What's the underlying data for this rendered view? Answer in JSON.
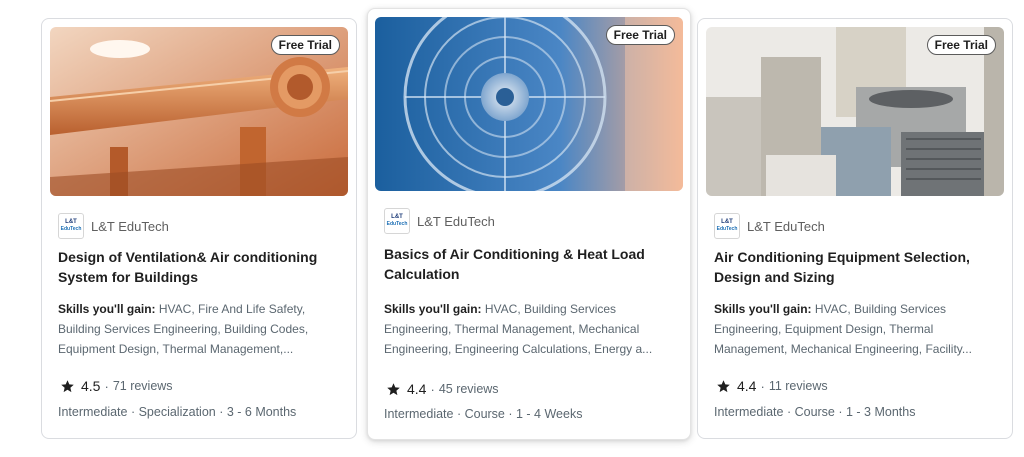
{
  "cards": [
    {
      "badge": "Free Trial",
      "partner": "L&T EduTech",
      "partner_logo_line1": "L&T",
      "partner_logo_line2": "EduTech",
      "title": "Design of Ventilation& Air conditioning System for Buildings",
      "skills_label": "Skills you'll gain:",
      "skills": "HVAC, Fire And Life Safety, Building Services Engineering, Building Codes, Equipment Design, Thermal Management,...",
      "rating": "4.5",
      "separator": "·",
      "reviews": "71 reviews",
      "meta": "Intermediate · Specialization · 3 - 6 Months",
      "image_icon": "ventilation-ducts-image"
    },
    {
      "badge": "Free Trial",
      "partner": "L&T EduTech",
      "partner_logo_line1": "L&T",
      "partner_logo_line2": "EduTech",
      "title": "Basics of Air Conditioning & Heat Load Calculation",
      "skills_label": "Skills you'll gain:",
      "skills": "HVAC, Building Services Engineering, Thermal Management, Mechanical Engineering, Engineering Calculations, Energy a...",
      "rating": "4.4",
      "separator": "·",
      "reviews": "45 reviews",
      "meta": "Intermediate · Course · 1 - 4 Weeks",
      "image_icon": "industrial-fan-image"
    },
    {
      "badge": "Free Trial",
      "partner": "L&T EduTech",
      "partner_logo_line1": "L&T",
      "partner_logo_line2": "EduTech",
      "title": "Air Conditioning Equipment Selection, Design and Sizing",
      "skills_label": "Skills you'll gain:",
      "skills": "HVAC, Building Services Engineering, Equipment Design, Thermal Management, Mechanical Engineering, Facility...",
      "rating": "4.4",
      "separator": "·",
      "reviews": "11 reviews",
      "meta": "Intermediate · Course · 1 - 3 Months",
      "image_icon": "ac-units-image"
    }
  ]
}
